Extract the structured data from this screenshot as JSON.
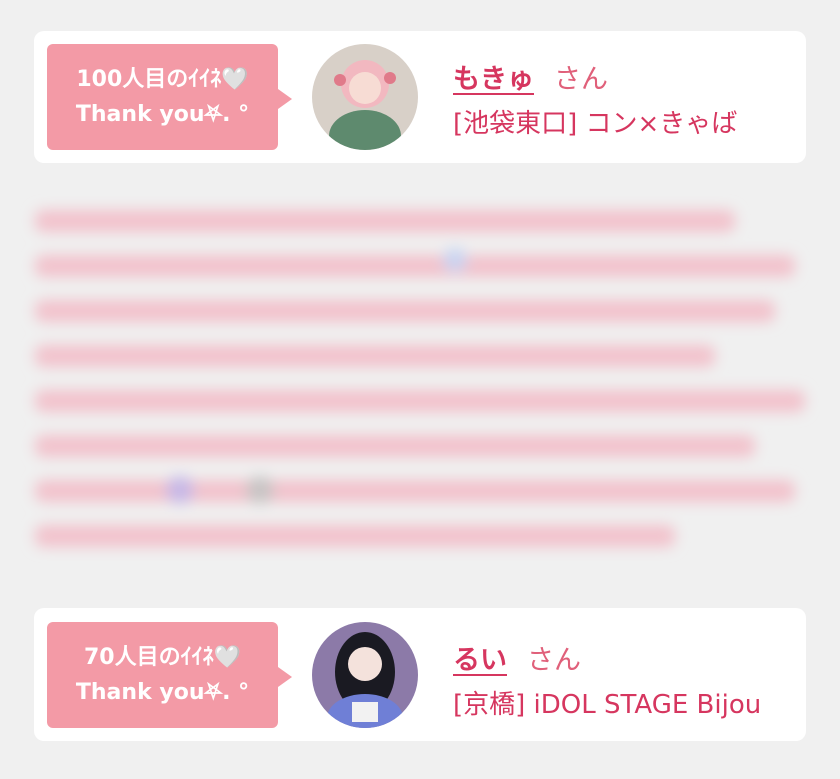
{
  "cards": [
    {
      "bubble_line1": "100人目のｲｲﾈ🤍",
      "bubble_line2": "Thank you⛧. °",
      "name": "もきゅ",
      "suffix": "さん",
      "shop": "[池袋東口] コン×きゃば"
    },
    {
      "bubble_line1": "70人目のｲｲﾈ🤍",
      "bubble_line2": "Thank you⛧. °",
      "name": "るい",
      "suffix": "さん",
      "shop": "[京橋] iDOL STAGE Bijou"
    }
  ],
  "colors": {
    "background": "#f0f0f0",
    "bubble": "#f39aa6",
    "accent_text": "#d6365f"
  }
}
